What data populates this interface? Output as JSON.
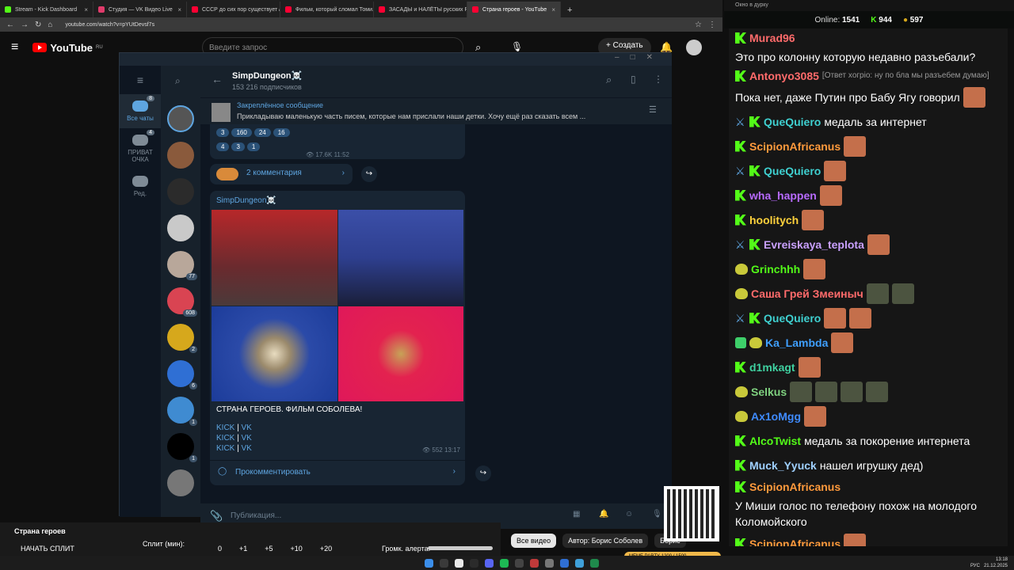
{
  "browser": {
    "tabs": [
      {
        "title": "Stream - Kick Dashboard",
        "color": "#53fc18",
        "active": false
      },
      {
        "title": "Студия — VK Видео Live",
        "color": "#e03b6b",
        "active": false
      },
      {
        "title": "СССР до сих пор существует / ...",
        "color": "#ff0033",
        "active": false
      },
      {
        "title": "Фильм, который сломал Томи...",
        "color": "#ff0033",
        "active": false
      },
      {
        "title": "ЗАСАДЫ и НАЛЁТЫ русских Р...",
        "color": "#ff0033",
        "active": false
      },
      {
        "title": "Страна героев - YouTube",
        "color": "#ff0033",
        "active": true
      }
    ],
    "url": "youtube.com/watch?v=pYUtDevsf7s"
  },
  "youtube": {
    "logo": "YouTube",
    "region": "RU",
    "search_placeholder": "Введите запрос",
    "create_label": "+ Создать",
    "video_title": "Страна героев",
    "chips": [
      "Все видео",
      "Автор: Борис Соболев",
      "Борис"
    ]
  },
  "telegram": {
    "folders": [
      {
        "label": "Все чаты",
        "badge": "8"
      },
      {
        "label": "ПРИВАТ ОЧКА",
        "badge": "4"
      },
      {
        "label": "Ред.",
        "badge": ""
      }
    ],
    "chat_avatars": [
      {
        "badge": "",
        "color": "#555"
      },
      {
        "badge": "",
        "color": "#8a5a3c"
      },
      {
        "badge": "",
        "color": "#2b2b2b"
      },
      {
        "badge": "",
        "color": "#c9c9c9"
      },
      {
        "badge": "77",
        "color": "#b8a79a"
      },
      {
        "badge": "608",
        "color": "#d94452"
      },
      {
        "badge": "2",
        "color": "#d6a81c"
      },
      {
        "badge": "6",
        "color": "#2f6fd4"
      },
      {
        "badge": "1",
        "color": "#3f8bd1"
      },
      {
        "badge": "1",
        "color": "#000000"
      },
      {
        "badge": "",
        "color": "#777"
      }
    ],
    "channel_name": "SimpDungeon☠️",
    "subscribers": "153 216 подписчиков",
    "pinned_title": "Закреплённое сообщение",
    "pinned_text": "Прикладываю маленькую часть писем, которые нам прислали наши детки.   Хочу ещё раз сказать всем ...",
    "prev_message": {
      "reactions_row1": [
        "3",
        "160",
        "24",
        "16"
      ],
      "reactions_row2": [
        "4",
        "3",
        "1"
      ],
      "views": "17.6K",
      "time": "11:52",
      "comments": "2 комментария"
    },
    "message": {
      "author": "SimpDungeon☠️",
      "text": "СТРАНА ГЕРОЕВ. ФИЛЬМ СОБОЛЕВА!",
      "links": [
        {
          "a": "KICK",
          "b": "VK"
        },
        {
          "a": "KICK",
          "b": "VK"
        },
        {
          "a": "KICK",
          "b": "VK"
        }
      ],
      "views": "552",
      "time": "13:17",
      "comment_label": "Прокомментировать"
    },
    "composer_placeholder": "Публикация..."
  },
  "player_controls": {
    "start_split": "НАЧАТЬ СПЛИТ",
    "split_label": "Сплит (мин):",
    "values": [
      "0",
      "+1",
      "+5",
      "+10",
      "+20"
    ],
    "alert_label": "Громк. алерта:"
  },
  "kick": {
    "window_title": "Окно в дурку",
    "online_label": "Online:",
    "online": "1541",
    "count1": "944",
    "count2": "597",
    "messages": [
      {
        "user": "Murad96",
        "color": "#ff6b6b",
        "text": "Это про колонну которую недавно разъебали?",
        "badges": [
          "kick"
        ],
        "emotes": 0
      },
      {
        "user": "Antonyo3085",
        "color": "#ff6b6b",
        "reply": "[Ответ xогрio: ну по бла мы разъебем думаю]",
        "text": "Пока нет, даже Путин про Бабу Ягу говорил",
        "badges": [
          "kick"
        ],
        "emotes": 1
      },
      {
        "user": "QueQuiero",
        "color": "#3fd0d0",
        "text": "медаль за интернет",
        "badges": [
          "sword",
          "kick"
        ],
        "emotes": 0
      },
      {
        "user": "ScipionAfricanus",
        "color": "#ff9a3c",
        "text": "",
        "badges": [
          "kick"
        ],
        "emotes": 1
      },
      {
        "user": "QueQuiero",
        "color": "#3fd0d0",
        "text": "",
        "badges": [
          "sword",
          "kick"
        ],
        "emotes": 1
      },
      {
        "user": "wha_happen",
        "color": "#b86bff",
        "text": "",
        "badges": [
          "kick"
        ],
        "emotes": 1
      },
      {
        "user": "hoolitych",
        "color": "#ffd23c",
        "text": "",
        "badges": [
          "kick"
        ],
        "emotes": 1
      },
      {
        "user": "Evreiskaya_teplota",
        "color": "#c9a0ff",
        "text": "",
        "badges": [
          "sword",
          "kick"
        ],
        "emotes": 1
      },
      {
        "user": "Grinchhh",
        "color": "#53fc18",
        "text": "",
        "badges": [
          "emoji"
        ],
        "emotes": 1
      },
      {
        "user": "Саша Грей Змеиныч",
        "color": "#ff6b6b",
        "text": "",
        "badges": [
          "emoji"
        ],
        "emotes": 2
      },
      {
        "user": "QueQuiero",
        "color": "#3fd0d0",
        "text": "",
        "badges": [
          "sword",
          "kick"
        ],
        "emotes": 2
      },
      {
        "user": "Ka_Lambda",
        "color": "#3fa0ff",
        "text": "",
        "badges": [
          "shield",
          "emoji"
        ],
        "emotes": 1
      },
      {
        "user": "d1mkagt",
        "color": "#3fd0a0",
        "text": "",
        "badges": [
          "kick"
        ],
        "emotes": 1
      },
      {
        "user": "Selkus",
        "color": "#7fd07f",
        "text": "",
        "badges": [
          "emoji"
        ],
        "emotes": 4
      },
      {
        "user": "Ax1oMgg",
        "color": "#3f8bff",
        "text": "",
        "badges": [
          "emoji"
        ],
        "emotes": 1
      },
      {
        "user": "AlcoTwist",
        "color": "#53fc18",
        "text": "медаль за покорение интернета",
        "badges": [
          "kick"
        ],
        "emotes": 0
      },
      {
        "user": "Muck_Yyuck",
        "color": "#9fd0ff",
        "text": "нашел игрушку дед)",
        "badges": [
          "kick"
        ],
        "emotes": 0
      },
      {
        "user": "ScipionAfricanus",
        "color": "#ff9a3c",
        "text": "У Миши голос по телефону похож на молодого Коломойского",
        "badges": [
          "kick"
        ],
        "emotes": 0
      },
      {
        "user": "ScipionAfricanus",
        "color": "#ff9a3c",
        "text": "",
        "badges": [
          "kick"
        ],
        "emotes": 1
      }
    ]
  },
  "taskbar": {
    "lang": "РУС",
    "time": "13:18",
    "date": "21.12.2025"
  },
  "overlay": {
    "meme": "MEME PARTY",
    "progress": "1200 / 1500"
  }
}
